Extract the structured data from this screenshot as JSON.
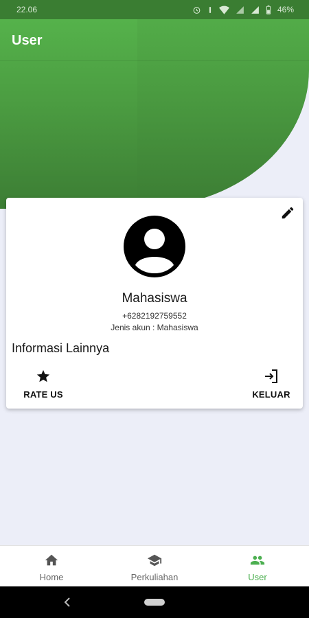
{
  "status_bar": {
    "time": "22.06",
    "battery": "46%"
  },
  "app_bar": {
    "title": "User"
  },
  "profile": {
    "name": "Mahasiswa",
    "phone": "+6282192759552",
    "account_type": "Jenis akun : Mahasiswa",
    "section_title": "Informasi Lainnya",
    "actions": [
      {
        "label": "RATE US",
        "icon": "star-icon"
      },
      {
        "label": "KELUAR",
        "icon": "logout-icon"
      }
    ]
  },
  "bottom_nav": {
    "items": [
      {
        "label": "Home",
        "icon": "home-icon",
        "active": false
      },
      {
        "label": "Perkuliahan",
        "icon": "school-icon",
        "active": false
      },
      {
        "label": "User",
        "icon": "people-icon",
        "active": true
      }
    ]
  },
  "colors": {
    "primary": "#4caf50",
    "header_dark": "#3c7d34",
    "background": "#eceef8"
  }
}
